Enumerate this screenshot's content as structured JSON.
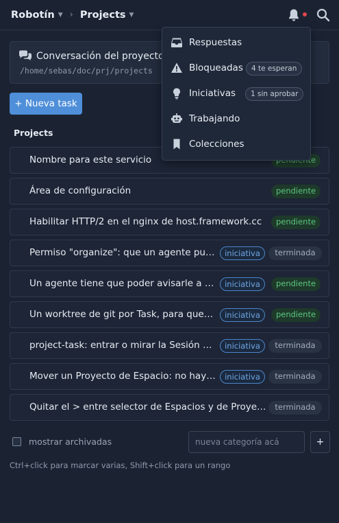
{
  "header": {
    "space": "Robotín",
    "separator": "›",
    "project": "Projects"
  },
  "conversation": {
    "title": "Conversación del proyecto",
    "path": "/home/sebas/doc/prj/projects"
  },
  "new_task_label": "+ Nueva task",
  "section_title": "Projects",
  "tasks": [
    {
      "title": "Nombre para este servicio",
      "status": "pendiente",
      "tag": ""
    },
    {
      "title": "Área de configuración",
      "status": "pendiente",
      "tag": ""
    },
    {
      "title": "Habilitar HTTP/2 en el nginx de host.framework.cc",
      "status": "pendiente",
      "tag": ""
    },
    {
      "title": "Permiso \"organize\": que un agente pue...",
      "status": "terminada",
      "tag": "iniciativa"
    },
    {
      "title": "Un agente tiene que poder avisarle a ot...",
      "status": "pendiente",
      "tag": "iniciativa"
    },
    {
      "title": "Un worktree de git por Task, para que d...",
      "status": "pendiente",
      "tag": "iniciativa"
    },
    {
      "title": "project-task: entrar o mirar la Sesión d...",
      "status": "terminada",
      "tag": "iniciativa"
    },
    {
      "title": "Mover un Proyecto de Espacio: no hay ...",
      "status": "terminada",
      "tag": "iniciativa"
    },
    {
      "title": "Quitar el > entre selector de Espacios y de Proyectos",
      "status": "terminada",
      "tag": ""
    }
  ],
  "footer": {
    "archived_label": "mostrar archivadas",
    "category_placeholder": "nueva categoría acá",
    "add_label": "+",
    "hint": "Ctrl+click para marcar varias, Shift+click para un rango"
  },
  "menu": {
    "items": [
      {
        "label": "Respuestas",
        "icon": "inbox-icon",
        "badge": ""
      },
      {
        "label": "Bloqueadas",
        "icon": "warning-icon",
        "badge": "4 te esperan"
      },
      {
        "label": "Iniciativas",
        "icon": "lightbulb-icon",
        "badge": "1 sin aprobar"
      },
      {
        "label": "Trabajando",
        "icon": "robot-icon",
        "badge": ""
      },
      {
        "label": "Colecciones",
        "icon": "bookmark-icon",
        "badge": ""
      }
    ]
  },
  "colors": {
    "background": "#1b2333",
    "accent": "#4f8fd9",
    "pending": "#5cc77e",
    "notification": "#e0474c"
  }
}
